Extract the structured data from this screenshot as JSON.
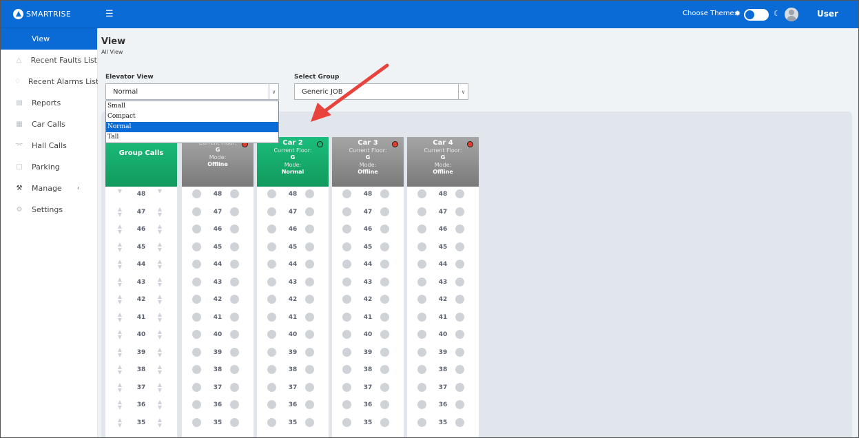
{
  "app": {
    "logo_text": "SMARTRISE"
  },
  "header": {
    "menu_icon": "hamburger-icon",
    "theme_label": "Choose Theme:",
    "sun_icon": "sun-icon",
    "moon_icon": "moon-icon",
    "user_name": "User"
  },
  "sidebar": {
    "items": [
      {
        "label": "View",
        "icon": "view-icon",
        "active": true
      },
      {
        "label": "Recent Faults List",
        "icon": "warning-icon"
      },
      {
        "label": "Recent Alarms List",
        "icon": "bell-icon"
      },
      {
        "label": "Reports",
        "icon": "document-icon"
      },
      {
        "label": "Car Calls",
        "icon": "keypad-icon"
      },
      {
        "label": "Hall Calls",
        "icon": "hall-icon"
      },
      {
        "label": "Parking",
        "icon": "parking-icon"
      },
      {
        "label": "Manage",
        "icon": "wrench-icon",
        "chevron": "‹"
      },
      {
        "label": "Settings",
        "icon": "gear-icon"
      }
    ]
  },
  "page": {
    "title": "View",
    "subtitle": "All View"
  },
  "elevator_view": {
    "label": "Elevator View",
    "value": "Normal",
    "options": [
      "Small",
      "Compact",
      "Normal",
      "Tall"
    ],
    "selected_index": 2
  },
  "select_group": {
    "label": "Select Group",
    "value": "Generic JOB"
  },
  "group_calls": {
    "title": "Group Calls"
  },
  "cars": [
    {
      "name": "",
      "floor_label": "Current Floor:",
      "floor": "G",
      "mode_label": "Mode:",
      "mode": "Offline",
      "status": "offline",
      "status_color": "#e03c2c"
    },
    {
      "name": "Car 2",
      "floor_label": "Current Floor:",
      "floor": "G",
      "mode_label": "Mode:",
      "mode": "Normal",
      "status": "online",
      "status_color": "#18b46f"
    },
    {
      "name": "Car 3",
      "floor_label": "Current Floor:",
      "floor": "G",
      "mode_label": "Mode:",
      "mode": "Offline",
      "status": "offline",
      "status_color": "#e03c2c"
    },
    {
      "name": "Car 4",
      "floor_label": "Current Floor:",
      "floor": "G",
      "mode_label": "Mode:",
      "mode": "Offline",
      "status": "offline",
      "status_color": "#e03c2c"
    }
  ],
  "floors": [
    "48",
    "47",
    "46",
    "45",
    "44",
    "43",
    "42",
    "41",
    "40",
    "39",
    "38",
    "37",
    "36",
    "35"
  ],
  "colors": {
    "brand_blue": "#0b6bd6",
    "green": "#18b46f",
    "red_status": "#e03c2c",
    "annotation_arrow": "#e8433c"
  }
}
